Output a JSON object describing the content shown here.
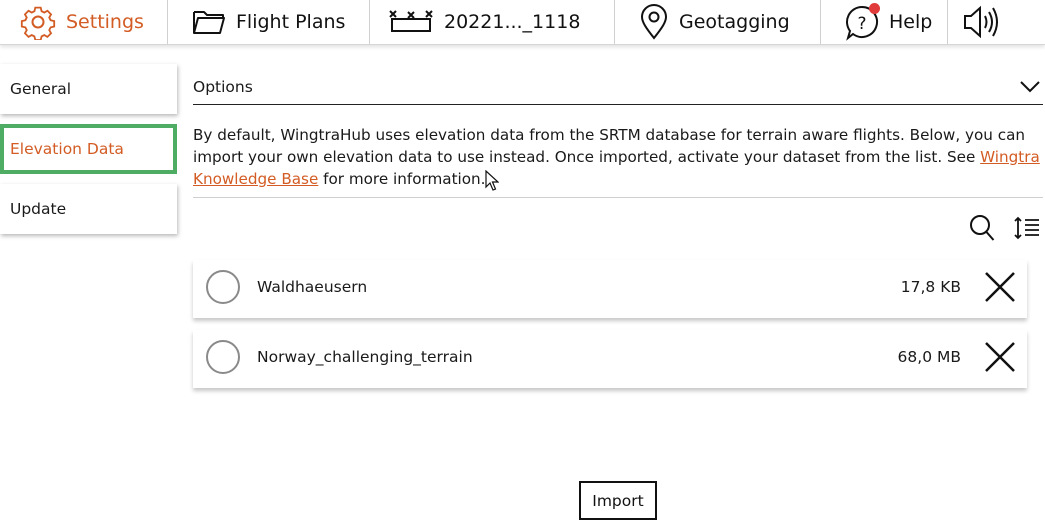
{
  "nav": {
    "settings": "Settings",
    "flight_plans": "Flight Plans",
    "flight": "20221..._1118",
    "geotagging": "Geotagging",
    "help": "Help"
  },
  "sidebar": {
    "items": [
      {
        "label": "General",
        "active": false
      },
      {
        "label": "Elevation Data",
        "active": true
      },
      {
        "label": "Update",
        "active": false
      }
    ]
  },
  "options": {
    "title": "Options"
  },
  "description": {
    "text1": "By default, WingtraHub uses elevation data from the SRTM database for terrain aware flights. Below, you can import your own elevation data to use instead. Once imported, activate your dataset from the list. See ",
    "link": "Wingtra Knowledge Base",
    "text2": " for more information."
  },
  "datasets": [
    {
      "name": "Waldhaeusern",
      "size": "17,8 KB"
    },
    {
      "name": "Norway_challenging_terrain",
      "size": "68,0 MB"
    }
  ],
  "import_label": "Import",
  "colors": {
    "accent": "#d35c24",
    "active_border": "#4fad63",
    "notification": "#e03a3a"
  }
}
